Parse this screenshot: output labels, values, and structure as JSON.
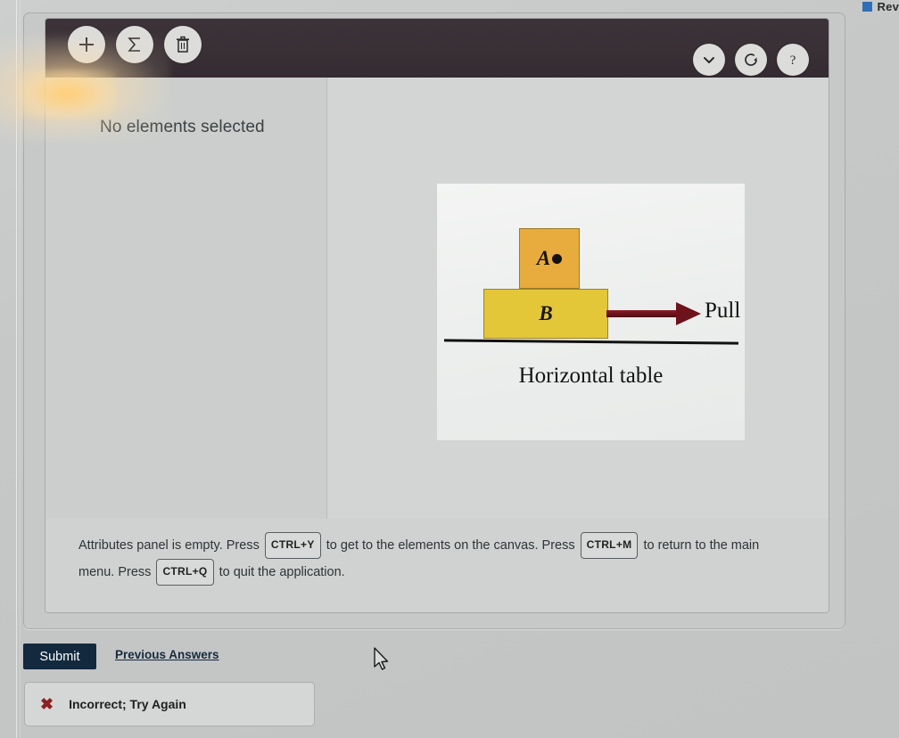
{
  "top_bar": {
    "review_label": "Rev",
    "review_icon": "blue-square-icon"
  },
  "toolbar": {
    "left_buttons": [
      {
        "name": "add-element-button",
        "icon": "plus-icon",
        "label": "+"
      },
      {
        "name": "sum-element-button",
        "icon": "sigma-icon",
        "label": "Σ"
      },
      {
        "name": "delete-element-button",
        "icon": "trash-icon",
        "label": "trash"
      }
    ],
    "right_buttons": [
      {
        "name": "more-options-button",
        "icon": "chevron-down-icon",
        "label": "⌄"
      },
      {
        "name": "undo-button",
        "icon": "undo-circular-arrow-icon",
        "label": "undo"
      },
      {
        "name": "help-button",
        "icon": "question-mark-icon",
        "label": "?"
      }
    ]
  },
  "attributes_panel": {
    "empty_message": "No elements selected"
  },
  "figure": {
    "block_a_label": "A",
    "block_b_label": "B",
    "force_label": "Pull",
    "caption": "Horizontal table",
    "block_a_color": "#e8ab3d",
    "block_b_color": "#e3c739",
    "arrow_color": "#6e121c"
  },
  "hint": {
    "part1": "Attributes panel is empty. Press",
    "key1": "CTRL+Y",
    "part2": "to get to the elements on the canvas. Press",
    "key2": "CTRL+M",
    "part3": "to return to the main menu. Press",
    "key3": "CTRL+Q",
    "part4": "to quit the application."
  },
  "footer": {
    "submit_label": "Submit",
    "previous_answers_label": "Previous Answers",
    "feedback_icon": "x-mark-icon",
    "feedback_text": "Incorrect; Try Again",
    "feedback_color": "#8c1f1f"
  }
}
